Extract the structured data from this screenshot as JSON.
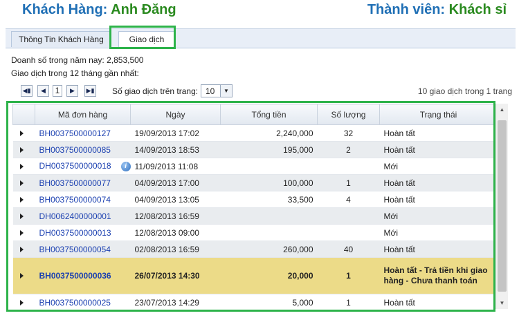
{
  "header": {
    "customer_label": "Khách Hàng:",
    "customer_name": "Anh Đăng",
    "member_label": "Thành viên:",
    "member_value": "Khách sỉ"
  },
  "tabs": [
    {
      "label": "Thông Tin Khách Hàng",
      "active": false
    },
    {
      "label": "Giao dịch",
      "active": true
    }
  ],
  "info": {
    "revenue_line": "Doanh số trong năm nay: 2,853,500",
    "recent_line": "Giao dịch trong 12 tháng gần nhất:"
  },
  "pager": {
    "current_page": "1",
    "per_page_label": "Số giao dịch trên trang:",
    "per_page_value": "10",
    "summary": "10 giao dịch trong 1 trang"
  },
  "grid": {
    "columns": [
      "Mã đơn hàng",
      "Ngày",
      "Tổng tiền",
      "Số lượng",
      "Trạng thái"
    ],
    "rows": [
      {
        "order": "BH0037500000127",
        "date": "19/09/2013 17:02",
        "total": "2,240,000",
        "qty": "32",
        "status": "Hoàn tất"
      },
      {
        "order": "BH0037500000085",
        "date": "14/09/2013 18:53",
        "total": "195,000",
        "qty": "2",
        "status": "Hoàn tất"
      },
      {
        "order": "DH0037500000018",
        "date": "11/09/2013 11:08",
        "total": "",
        "qty": "",
        "status": "Mới"
      },
      {
        "order": "BH0037500000077",
        "date": "04/09/2013 17:00",
        "total": "100,000",
        "qty": "1",
        "status": "Hoàn tất"
      },
      {
        "order": "BH0037500000074",
        "date": "04/09/2013 13:05",
        "total": "33,500",
        "qty": "4",
        "status": "Hoàn tất"
      },
      {
        "order": "DH0062400000001",
        "date": "12/08/2013 16:59",
        "total": "",
        "qty": "",
        "status": "Mới"
      },
      {
        "order": "DH0037500000013",
        "date": "12/08/2013 09:00",
        "total": "",
        "qty": "",
        "status": "Mới"
      },
      {
        "order": "BH0037500000054",
        "date": "02/08/2013 16:59",
        "total": "260,000",
        "qty": "40",
        "status": "Hoàn tất"
      },
      {
        "order": "BH0037500000036",
        "date": "26/07/2013 14:30",
        "total": "20,000",
        "qty": "1",
        "status": "Hoàn tất - Trả tiền khi giao hàng - Chưa thanh toán"
      },
      {
        "order": "BH0037500000025",
        "date": "23/07/2013 14:29",
        "total": "5,000",
        "qty": "1",
        "status": "Hoàn tất"
      }
    ]
  },
  "colors": {
    "highlight": "#2db34a",
    "selected_row": "#ecdb88",
    "title_blue": "#1f6fb5",
    "title_green": "#2a8a1f"
  }
}
